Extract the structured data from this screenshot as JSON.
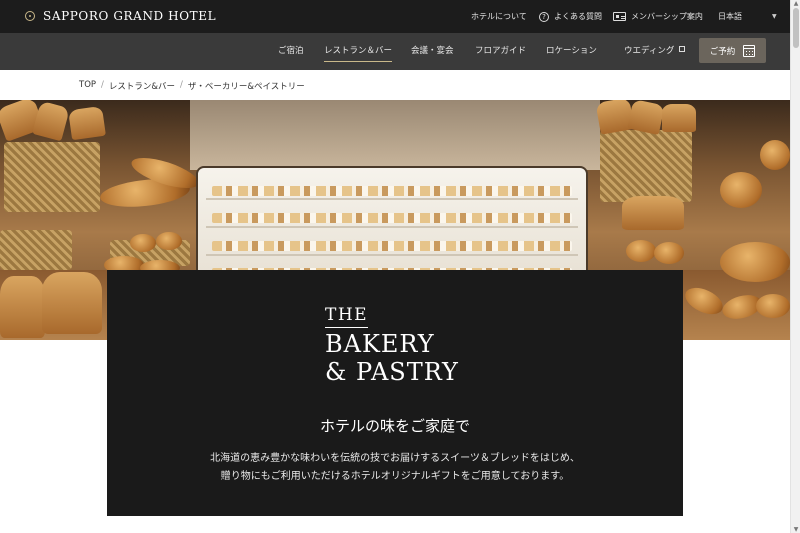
{
  "header": {
    "logo_text": "SAPPORO GRAND HOTEL",
    "utility": {
      "about": "ホテルについて",
      "faq": "よくある質問",
      "membership": "メンバーシップ案内",
      "language": "日本語"
    }
  },
  "nav": {
    "items": [
      {
        "label": "ご宿泊"
      },
      {
        "label": "レストラン＆バー"
      },
      {
        "label": "会議・宴会"
      },
      {
        "label": "フロアガイド"
      },
      {
        "label": "ロケーション"
      },
      {
        "label": "ウエディング"
      }
    ],
    "active": "レストラン＆バー",
    "reserve_label": "ご予約"
  },
  "breadcrumb": {
    "items": [
      "TOP",
      "レストラン&バー",
      "ザ・ベーカリー&ペイストリー"
    ],
    "separator": "/"
  },
  "card": {
    "brand_line1": "THE",
    "brand_line2": "BAKERY",
    "brand_line3": "& PASTRY",
    "title": "ホテルの味をご家庭で",
    "description_line1": "北海道の恵み豊かな味わいを伝統の技でお届けするスイーツ＆ブレッドをはじめ、",
    "description_line2": "贈り物にもご利用いただけるホテルオリジナルギフトをご用意しております。"
  },
  "icons": {
    "faq": "question-circle-icon",
    "membership": "member-card-icon",
    "language": "chevron-down-icon",
    "wedding": "external-link-icon",
    "reserve": "calendar-icon"
  },
  "colors": {
    "topbar": "#1c1c1c",
    "navbar": "#3a3a3a",
    "accent_gold": "#c9b88a",
    "reserve_button": "#6b655c",
    "card": "#1a1a1a"
  }
}
